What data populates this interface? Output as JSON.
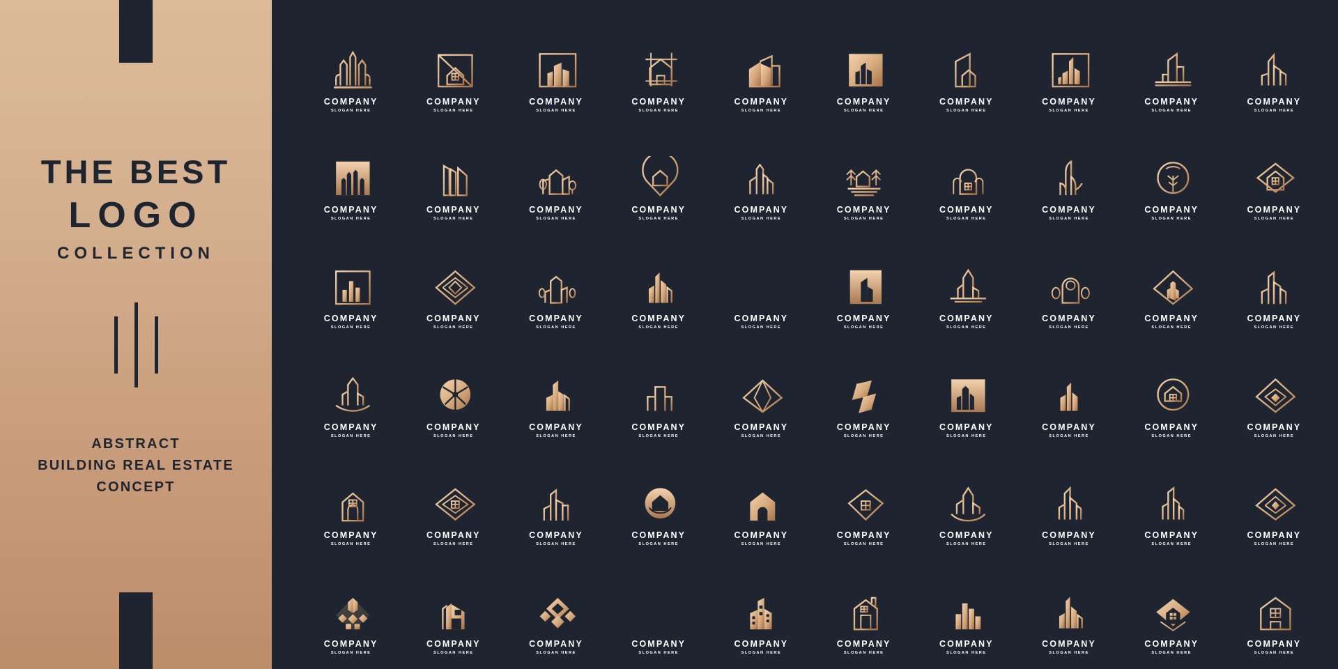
{
  "left_panel": {
    "title_line1": "THE BEST",
    "title_line2": "LOGO",
    "title_line3": "COLLECTION",
    "subtitle_line1": "ABSTRACT",
    "subtitle_line2": "BUILDING REAL ESTATE",
    "subtitle_line3": "CONCEPT",
    "background_gradient_top": "#ddbb99",
    "background_gradient_bottom": "#bd8d6a",
    "text_color": "#1e2530"
  },
  "logo_panel": {
    "background_color": "#1e2530",
    "gold_light": "#f0cda6",
    "gold_dark": "#b07d4e",
    "company_label": "COMPANY",
    "slogan_label": "SLOGAN HERE",
    "columns": 10,
    "rows": 6,
    "total_logos": 60,
    "logos": [
      {
        "index": 1,
        "icon": "skyline-towers-line-icon"
      },
      {
        "index": 2,
        "icon": "house-in-square-slash-icon"
      },
      {
        "index": 3,
        "icon": "buildings-in-frame-icon"
      },
      {
        "index": 4,
        "icon": "house-scaffold-grid-icon"
      },
      {
        "index": 5,
        "icon": "folded-house-blocks-icon"
      },
      {
        "index": 6,
        "icon": "towers-in-filled-square-icon"
      },
      {
        "index": 7,
        "icon": "angled-house-outline-icon"
      },
      {
        "index": 8,
        "icon": "skyscrapers-in-frame-icon"
      },
      {
        "index": 9,
        "icon": "tower-on-base-line-icon"
      },
      {
        "index": 10,
        "icon": "twin-skyscrapers-line-icon"
      },
      {
        "index": 11,
        "icon": "towers-gradient-square-icon"
      },
      {
        "index": 12,
        "icon": "tilted-building-slabs-icon"
      },
      {
        "index": 13,
        "icon": "buildings-with-trees-icon"
      },
      {
        "index": 14,
        "icon": "house-pin-marker-icon"
      },
      {
        "index": 15,
        "icon": "tall-towers-cluster-icon"
      },
      {
        "index": 16,
        "icon": "house-pines-lake-icon"
      },
      {
        "index": 17,
        "icon": "arch-house-trees-icon"
      },
      {
        "index": 18,
        "icon": "leaf-tower-line-icon"
      },
      {
        "index": 19,
        "icon": "tree-in-circle-icon"
      },
      {
        "index": 20,
        "icon": "diamond-roof-house-icon"
      },
      {
        "index": 21,
        "icon": "city-blocks-in-frame-icon"
      },
      {
        "index": 22,
        "icon": "rhombus-lattice-icon"
      },
      {
        "index": 23,
        "icon": "towers-with-saplings-icon"
      },
      {
        "index": 24,
        "icon": "stepped-skyline-icon"
      },
      {
        "index": 25,
        "icon": "vertical-bars-skyline-icon"
      },
      {
        "index": 26,
        "icon": "building-in-gold-square-icon"
      },
      {
        "index": 27,
        "icon": "spire-tower-base-icon"
      },
      {
        "index": 28,
        "icon": "dome-building-trees-icon"
      },
      {
        "index": 29,
        "icon": "diamond-with-towers-icon"
      },
      {
        "index": 30,
        "icon": "modern-towers-line-icon"
      },
      {
        "index": 31,
        "icon": "spire-crystal-tower-icon"
      },
      {
        "index": 32,
        "icon": "pinwheel-in-circle-icon"
      },
      {
        "index": 33,
        "icon": "twin-tower-blocks-icon"
      },
      {
        "index": 34,
        "icon": "stacked-boxes-outline-icon"
      },
      {
        "index": 35,
        "icon": "faceted-diamond-roof-icon"
      },
      {
        "index": 36,
        "icon": "folded-ribbon-block-icon"
      },
      {
        "index": 37,
        "icon": "towers-filled-square-icon"
      },
      {
        "index": 38,
        "icon": "city-towers-line-icon"
      },
      {
        "index": 39,
        "icon": "house-in-circle-icon"
      },
      {
        "index": 40,
        "icon": "diamond-facet-star-icon"
      },
      {
        "index": 41,
        "icon": "house-arch-door-icon"
      },
      {
        "index": 42,
        "icon": "diamond-quilt-house-icon"
      },
      {
        "index": 43,
        "icon": "tower-pair-outline-icon"
      },
      {
        "index": 44,
        "icon": "leaf-house-circle-icon"
      },
      {
        "index": 45,
        "icon": "solid-house-arch-icon"
      },
      {
        "index": 46,
        "icon": "pentagon-window-house-icon"
      },
      {
        "index": 47,
        "icon": "crystal-spire-tower-icon"
      },
      {
        "index": 48,
        "icon": "angular-skyline-icon"
      },
      {
        "index": 49,
        "icon": "tall-tower-stack-icon"
      },
      {
        "index": 50,
        "icon": "diamond-roof-frame-icon"
      },
      {
        "index": 51,
        "icon": "mosaic-diamond-peak-icon"
      },
      {
        "index": 52,
        "icon": "solid-house-block-icon"
      },
      {
        "index": 53,
        "icon": "diamond-lattice-bloom-icon"
      },
      {
        "index": 54,
        "icon": "line-bars-skyline-icon"
      },
      {
        "index": 55,
        "icon": "solid-city-blocks-icon"
      },
      {
        "index": 56,
        "icon": "house-with-chimney-icon"
      },
      {
        "index": 57,
        "icon": "bar-towers-solid-icon"
      },
      {
        "index": 58,
        "icon": "sharp-skyline-icon"
      },
      {
        "index": 59,
        "icon": "diamond-window-house-icon"
      },
      {
        "index": 60,
        "icon": "house-window-outline-icon"
      }
    ]
  }
}
